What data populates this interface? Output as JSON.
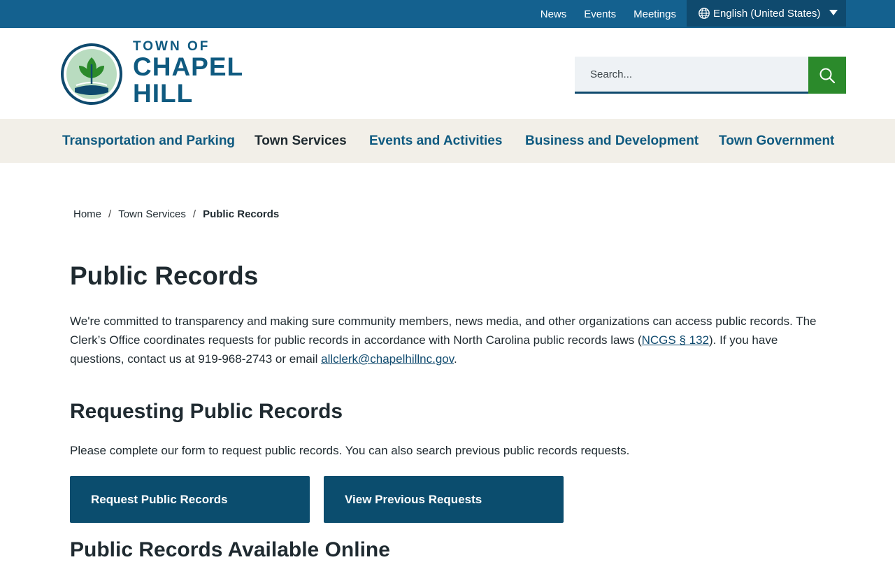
{
  "utility_nav": {
    "links": [
      "News",
      "Events",
      "Meetings"
    ],
    "language": "English (United States)"
  },
  "logo": {
    "line1": "TOWN OF",
    "line2": "CHAPEL",
    "line3": "HILL"
  },
  "search": {
    "placeholder": "Search..."
  },
  "main_nav": {
    "items": [
      "Transportation and Parking",
      "Town Services",
      "Events and Activities",
      "Business and Development",
      "Town Government"
    ]
  },
  "breadcrumb": {
    "items": [
      "Home",
      "Town Services",
      "Public Records"
    ],
    "separator": "/"
  },
  "page": {
    "title": "Public Records",
    "intro_part1": "We're committed to transparency and making sure community members, news media, and other organizations can access public records. The Clerk’s Office coordinates requests for public records in accordance with North Carolina public records laws (",
    "intro_link1": "NCGS § 132",
    "intro_part2": "). If you have questions, contact us at 919-968-2743 or email ",
    "intro_link2": "allclerk@chapelhillnc.gov",
    "intro_part3": "."
  },
  "requesting": {
    "heading": "Requesting Public Records",
    "text": "Please complete our form to request public records. You can also search previous public records requests.",
    "buttons": [
      "Request Public Records",
      "View Previous Requests"
    ]
  },
  "online": {
    "heading": "Public Records Available Online"
  },
  "colors": {
    "topbar": "#14618f",
    "brand": "#0f5a80",
    "search_button": "#2b8a2b",
    "nav_bg": "#f2efe8",
    "button": "#0b4d6e"
  }
}
